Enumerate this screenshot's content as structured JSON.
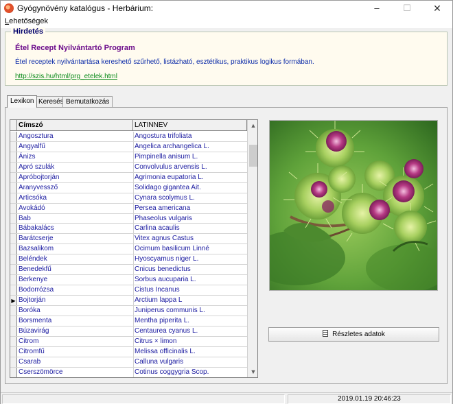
{
  "window": {
    "title": "Gyógynövény katalógus - Herbárium:",
    "minimize_glyph": "–",
    "maximize_glyph": "☐",
    "close_glyph": "✕"
  },
  "menu": {
    "first_letter": "L",
    "rest": "ehetőségek"
  },
  "ad": {
    "legend": "Hirdetés",
    "title": "Étel Recept Nyilvántartó Program",
    "description": "Étel receptek nyilvántartása kereshető szűrhető, listázható, esztétikus, praktikus logikus formában.",
    "link": "http://szis.hu/html/prg_etelek.html"
  },
  "tabs": [
    {
      "label": "Lexikon",
      "active": true
    },
    {
      "label": "Keresés",
      "active": false
    },
    {
      "label": "Bemutatkozás",
      "active": false
    }
  ],
  "grid": {
    "columns": [
      "Címszó",
      "LATINNEV"
    ],
    "current_row_marker": "▶",
    "rows": [
      {
        "cimszo": "Angosztura",
        "latin": "Angostura trifoliata"
      },
      {
        "cimszo": "Angyalfű",
        "latin": "Angelica archangelica L."
      },
      {
        "cimszo": "Ánizs",
        "latin": "Pimpinella anisum L."
      },
      {
        "cimszo": "Apró szulák",
        "latin": "Convolvulus arvensis L."
      },
      {
        "cimszo": "Apróbojtorján",
        "latin": "Agrimonia eupatoria L."
      },
      {
        "cimszo": "Aranyvessző",
        "latin": "Solidago gigantea Ait."
      },
      {
        "cimszo": "Articsóka",
        "latin": "Cynara scolymus L."
      },
      {
        "cimszo": "Avokádó",
        "latin": "Persea americana"
      },
      {
        "cimszo": "Bab",
        "latin": "Phaseolus vulgaris"
      },
      {
        "cimszo": "Bábakalács",
        "latin": "Carlina acaulis"
      },
      {
        "cimszo": "Barátcserje",
        "latin": "Vitex agnus Castus"
      },
      {
        "cimszo": "Bazsalikom",
        "latin": "Ocimum basilicum Linné"
      },
      {
        "cimszo": "Beléndek",
        "latin": "Hyoscyamus niger L."
      },
      {
        "cimszo": "Benedekfű",
        "latin": "Cnicus benedictus"
      },
      {
        "cimszo": "Berkenye",
        "latin": "Sorbus aucuparia L."
      },
      {
        "cimszo": "Bodorrózsa",
        "latin": "Cistus Incanus"
      },
      {
        "cimszo": "Bojtorján",
        "latin": "Arctium lappa L",
        "current": true
      },
      {
        "cimszo": "Boróka",
        "latin": "Juniperus communis L."
      },
      {
        "cimszo": "Borsmenta",
        "latin": "Mentha piperita L."
      },
      {
        "cimszo": "Búzavirág",
        "latin": "Centaurea cyanus L."
      },
      {
        "cimszo": "Citrom",
        "latin": "Citrus × limon"
      },
      {
        "cimszo": "Citromfű",
        "latin": "Melissa officinalis L."
      },
      {
        "cimszo": "Csarab",
        "latin": "Calluna vulgaris"
      },
      {
        "cimszo": "Cserszömörce",
        "latin": "Cotinus coggygria Scop."
      }
    ]
  },
  "scroll": {
    "up_glyph": "▲",
    "down_glyph": "▼"
  },
  "details_button": "Részletes adatok",
  "status": {
    "datetime": "2019.01.19 20:46:23"
  }
}
